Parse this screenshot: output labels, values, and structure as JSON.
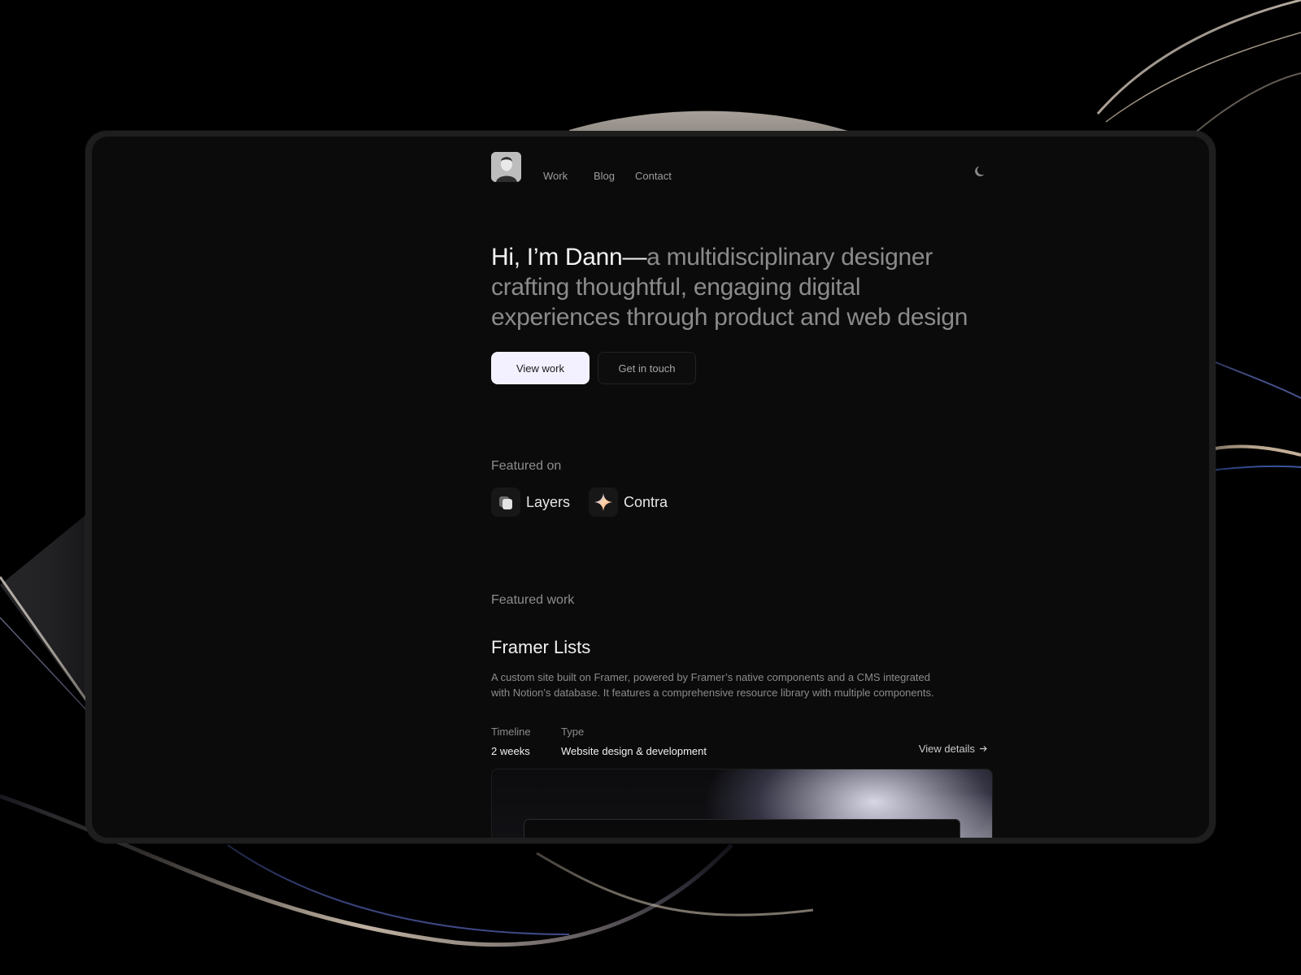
{
  "nav": {
    "links": [
      "Work",
      "Blog",
      "Contact"
    ]
  },
  "hero": {
    "lead": "Hi, I’m Dann—",
    "rest": "a multidisciplinary designer crafting thoughtful, engaging digital experiences through product and web design"
  },
  "buttons": {
    "primary": "View work",
    "secondary": "Get in touch"
  },
  "featured_on": {
    "label": "Featured on",
    "items": [
      {
        "name": "Layers",
        "icon": "layers-logo-icon"
      },
      {
        "name": "Contra",
        "icon": "contra-logo-icon"
      }
    ]
  },
  "featured_work": {
    "label": "Featured work",
    "project": {
      "title": "Framer Lists",
      "description": "A custom site built on Framer, powered by Framer’s native components and a CMS integrated with Notion’s database. It features a comprehensive resource library with multiple components.",
      "timeline_label": "Timeline",
      "timeline_value": "2 weeks",
      "type_label": "Type",
      "type_value": "Website design & development",
      "details_link": "View details"
    }
  },
  "colors": {
    "background": "#000000",
    "screen": "#0b0b0b",
    "primary_button": "#f3f1ff",
    "text_primary": "#f2f2f2",
    "text_muted": "#8b8b8b"
  }
}
